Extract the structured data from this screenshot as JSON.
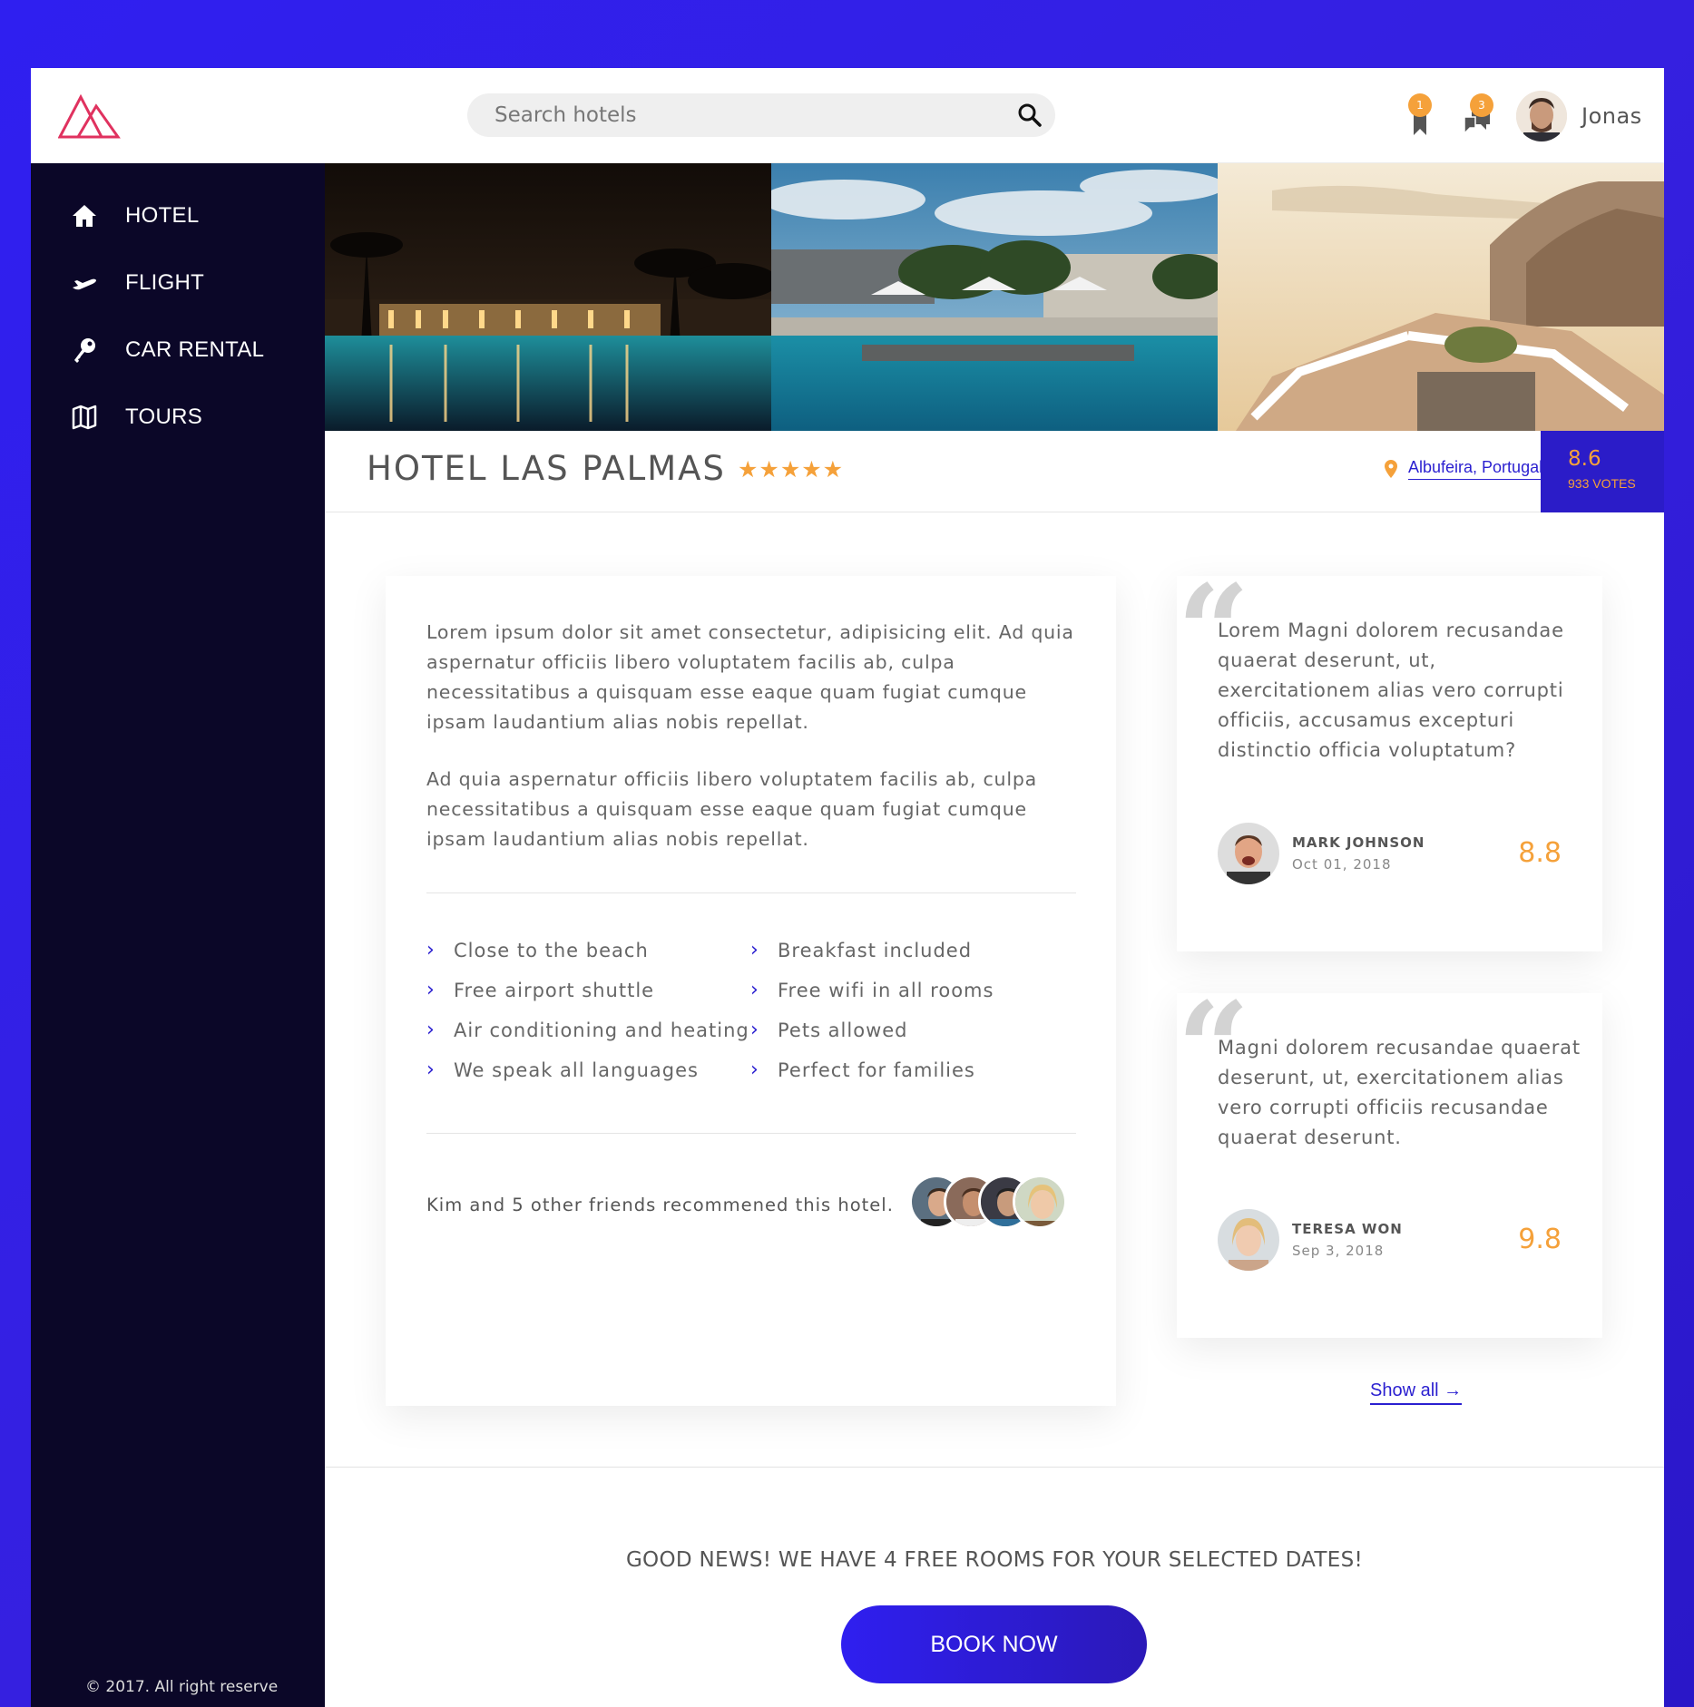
{
  "header": {
    "search_placeholder": "Search hotels",
    "bookmarks_badge": "1",
    "messages_badge": "3",
    "user_name": "Jonas"
  },
  "sidebar": {
    "items": [
      {
        "label": "HOTEL",
        "icon": "home-icon"
      },
      {
        "label": "FLIGHT",
        "icon": "plane-icon"
      },
      {
        "label": "CAR RENTAL",
        "icon": "key-icon"
      },
      {
        "label": "TOURS",
        "icon": "map-icon"
      }
    ],
    "copyright": "© 2017. All right reserve"
  },
  "hotel": {
    "name": "HOTEL LAS PALMAS",
    "stars": "★★★★★",
    "location": "Albufeira, Portugal",
    "rating": "8.6",
    "votes": "933 VOTES"
  },
  "description": {
    "p1": "Lorem ipsum dolor sit amet consectetur, adipisicing elit. Ad quia aspernatur officiis libero voluptatem facilis ab, culpa necessitatibus a quisquam esse eaque quam fugiat cumque ipsam laudantium alias nobis repellat.",
    "p2": "Ad quia aspernatur officiis libero voluptatem facilis ab, culpa necessitatibus a quisquam esse eaque quam fugiat cumque ipsam laudantium alias nobis repellat."
  },
  "features": [
    "Close to the beach",
    "Free airport shuttle",
    "Air conditioning and heating",
    "We speak all languages",
    "Breakfast included",
    "Free wifi in all rooms",
    "Pets allowed",
    "Perfect for families"
  ],
  "recommend_text": "Kim and 5 other friends recommened this hotel.",
  "reviews": [
    {
      "text": "Lorem Magni dolorem recusandae quaerat deserunt, ut, exercitationem alias vero corrupti officiis, accusamus excepturi distinctio officia voluptatum?",
      "name": "MARK JOHNSON",
      "date": "Oct 01, 2018",
      "score": "8.8"
    },
    {
      "text": "Magni dolorem recusandae quaerat deserunt, ut, exercitationem alias vero corrupti officiis recusandae quaerat deserunt.",
      "name": "TERESA WON",
      "date": "Sep 3, 2018",
      "score": "9.8"
    }
  ],
  "show_all": "Show all →",
  "cta": {
    "message": "GOOD NEWS! WE HAVE 4 FREE ROOMS FOR YOUR SELECTED DATES!",
    "button": "BOOK NOW"
  },
  "colors": {
    "accent": "#2a1fd0",
    "orange": "#f5a13a",
    "sidebar": "#0b0728"
  }
}
